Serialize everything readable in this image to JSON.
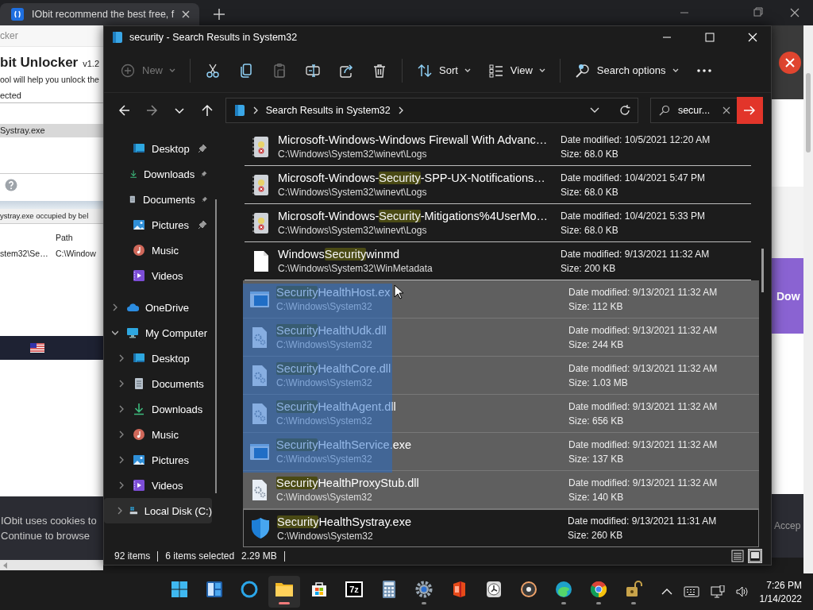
{
  "browser": {
    "tab_title": "IObit recommend the best free, f"
  },
  "unlocker": {
    "title": "cker",
    "app_name": "bit Unlocker",
    "version": "v1.2",
    "description": "ool will help you unlock the",
    "section_label": "ected",
    "selected_file": "Systray.exe",
    "occupied_message": "ystray.exe occupied by bel",
    "path_header": "Path",
    "rows": [
      {
        "column_1": "stem32\\Se…",
        "path": "C:\\Window"
      }
    ]
  },
  "web_page": {
    "cookie_notice": [
      "IObit uses cookies to",
      "Continue to browse"
    ],
    "download_button": "Dow",
    "accept_button": "Accep"
  },
  "explorer": {
    "title": "security - Search Results in System32",
    "toolbar": [
      [
        {
          "label": "New",
          "dropdown": true,
          "disabled": true
        }
      ],
      [
        {
          "dropdown": false,
          "disabled": false
        },
        {
          "dropdown": false,
          "disabled": false
        },
        {
          "dropdown": false,
          "disabled": true
        },
        {
          "dropdown": false,
          "disabled": false
        },
        {
          "dropdown": false,
          "disabled": false
        },
        {
          "dropdown": false,
          "disabled": false
        }
      ],
      [
        {
          "label": "Sort",
          "dropdown": true,
          "disabled": false
        },
        {
          "label": "View",
          "dropdown": true,
          "disabled": false
        }
      ],
      [
        {
          "label": "Search options",
          "dropdown": true,
          "disabled": false
        },
        {
          "dropdown": false,
          "disabled": false
        }
      ]
    ],
    "navigation": [
      {
        "disabled": false
      },
      {
        "disabled": true
      },
      {
        "disabled": false
      },
      {
        "disabled": false
      }
    ],
    "address": {
      "location": "Search Results in System32"
    },
    "search": {
      "value": "secur..."
    },
    "sidebar": {
      "quick_access": [
        {
          "label": "Desktop",
          "kind": "desktop",
          "pinned": true,
          "selected": false
        },
        {
          "label": "Downloads",
          "kind": "downloads",
          "pinned": true,
          "selected": false
        },
        {
          "label": "Documents",
          "kind": "documents",
          "pinned": true,
          "selected": false
        },
        {
          "label": "Pictures",
          "kind": "pictures",
          "pinned": true,
          "selected": false
        },
        {
          "label": "Music",
          "kind": "music",
          "pinned": false,
          "selected": false
        },
        {
          "label": "Videos",
          "kind": "videos",
          "pinned": false,
          "selected": false
        }
      ],
      "tree": [
        {
          "label": "OneDrive",
          "kind": "cloud",
          "expanded": false,
          "selected": false
        },
        {
          "label": "My Computer",
          "kind": "computer",
          "expanded": true,
          "selected": false,
          "children": [
            {
              "label": "Desktop",
              "kind": "desktop",
              "expanded": false,
              "selected": false
            },
            {
              "label": "Documents",
              "kind": "documents",
              "expanded": false,
              "selected": false
            },
            {
              "label": "Downloads",
              "kind": "downloads",
              "expanded": false,
              "selected": false
            },
            {
              "label": "Music",
              "kind": "music",
              "expanded": false,
              "selected": false
            },
            {
              "label": "Pictures",
              "kind": "pictures",
              "expanded": false,
              "selected": false
            },
            {
              "label": "Videos",
              "kind": "videos",
              "expanded": false,
              "selected": false
            },
            {
              "label": "Local Disk (C:)",
              "kind": "drive",
              "expanded": false,
              "selected": true
            }
          ]
        }
      ]
    },
    "files": [
      {
        "kind": "log",
        "name_start": "Microsoft-Windows-Windows Firewall With Advanc…",
        "path": "C:\\Windows\\System32\\winevt\\Logs",
        "date": "Date modified: 10/5/2021 12:20 AM",
        "size": "Size: 68.0 KB",
        "selected": false,
        "focused": false
      },
      {
        "kind": "log",
        "name_start": "Microsoft-Windows-",
        "match": "Security",
        "name_end": "-SPP-UX-Notifications…",
        "path": "C:\\Windows\\System32\\winevt\\Logs",
        "date": "Date modified: 10/4/2021 5:47 PM",
        "size": "Size: 68.0 KB",
        "selected": false,
        "focused": false
      },
      {
        "kind": "log",
        "name_start": "Microsoft-Windows-",
        "match": "Security",
        "name_end": "-Mitigations%4UserMo…",
        "path": "C:\\Windows\\System32\\winevt\\Logs",
        "date": "Date modified: 10/4/2021 5:33 PM",
        "size": "Size: 68.0 KB",
        "selected": false,
        "focused": false
      },
      {
        "kind": "blank",
        "name_start": "Windows",
        "match": "Security",
        "name_end": "winmd",
        "path": "C:\\Windows\\System32\\WinMetadata",
        "date": "Date modified: 9/13/2021 11:32 AM",
        "size": "Size: 200 KB",
        "selected": false,
        "focused": false
      },
      {
        "kind": "exe",
        "match": "Security",
        "name_end": "HealthHost.ex",
        "path": "C:\\Windows\\System32",
        "date": "Date modified: 9/13/2021 11:32 AM",
        "size": "Size: 112 KB",
        "selected": true,
        "focused": false
      },
      {
        "kind": "dll",
        "match": "Security",
        "name_end": "HealthUdk.dll",
        "path": "C:\\Windows\\System32",
        "date": "Date modified: 9/13/2021 11:32 AM",
        "size": "Size: 244 KB",
        "selected": true,
        "focused": false
      },
      {
        "kind": "dll",
        "match": "Security",
        "name_end": "HealthCore.dll",
        "path": "C:\\Windows\\System32",
        "date": "Date modified: 9/13/2021 11:32 AM",
        "size": "Size: 1.03 MB",
        "selected": true,
        "focused": false
      },
      {
        "kind": "dll",
        "match": "Security",
        "name_end": "HealthAgent.dll",
        "path": "C:\\Windows\\System32",
        "date": "Date modified: 9/13/2021 11:32 AM",
        "size": "Size: 656 KB",
        "selected": true,
        "focused": false
      },
      {
        "kind": "exe",
        "match": "Security",
        "name_end": "HealthService.exe",
        "path": "C:\\Windows\\System32",
        "date": "Date modified: 9/13/2021 11:32 AM",
        "size": "Size: 137 KB",
        "selected": true,
        "focused": false
      },
      {
        "kind": "dll",
        "match": "Security",
        "name_end": "HealthProxyStub.dll",
        "path": "C:\\Windows\\System32",
        "date": "Date modified: 9/13/2021 11:32 AM",
        "size": "Size: 140 KB",
        "selected": true,
        "focused": false
      },
      {
        "kind": "shield",
        "match": "Security",
        "name_end": "HealthSystray.exe",
        "path": "C:\\Windows\\System32",
        "date": "Date modified: 9/13/2021 11:31 AM",
        "size": "Size: 260 KB",
        "selected": false,
        "focused": true
      }
    ],
    "status_bar": {
      "item_count": "92 items",
      "selection": "6 items selected",
      "selection_size": "2.29 MB",
      "views": [
        {
          "selected": false
        },
        {
          "selected": true
        }
      ]
    }
  },
  "taskbar": {
    "apps": [
      {
        "running": false,
        "active": false
      },
      {
        "running": false,
        "active": false
      },
      {
        "running": false,
        "active": false
      },
      {
        "running": true,
        "active": true
      },
      {
        "running": false,
        "active": false
      },
      {
        "label": "7z",
        "running": false,
        "active": false
      },
      {
        "running": false,
        "active": false
      },
      {
        "running": true,
        "active": false
      },
      {
        "running": false,
        "active": false
      },
      {
        "running": false,
        "active": false
      },
      {
        "running": false,
        "active": false
      },
      {
        "running": true,
        "active": false
      },
      {
        "running": true,
        "active": false
      },
      {
        "running": true,
        "active": false
      }
    ],
    "time": "7:26 PM",
    "date": "1/14/2022"
  }
}
